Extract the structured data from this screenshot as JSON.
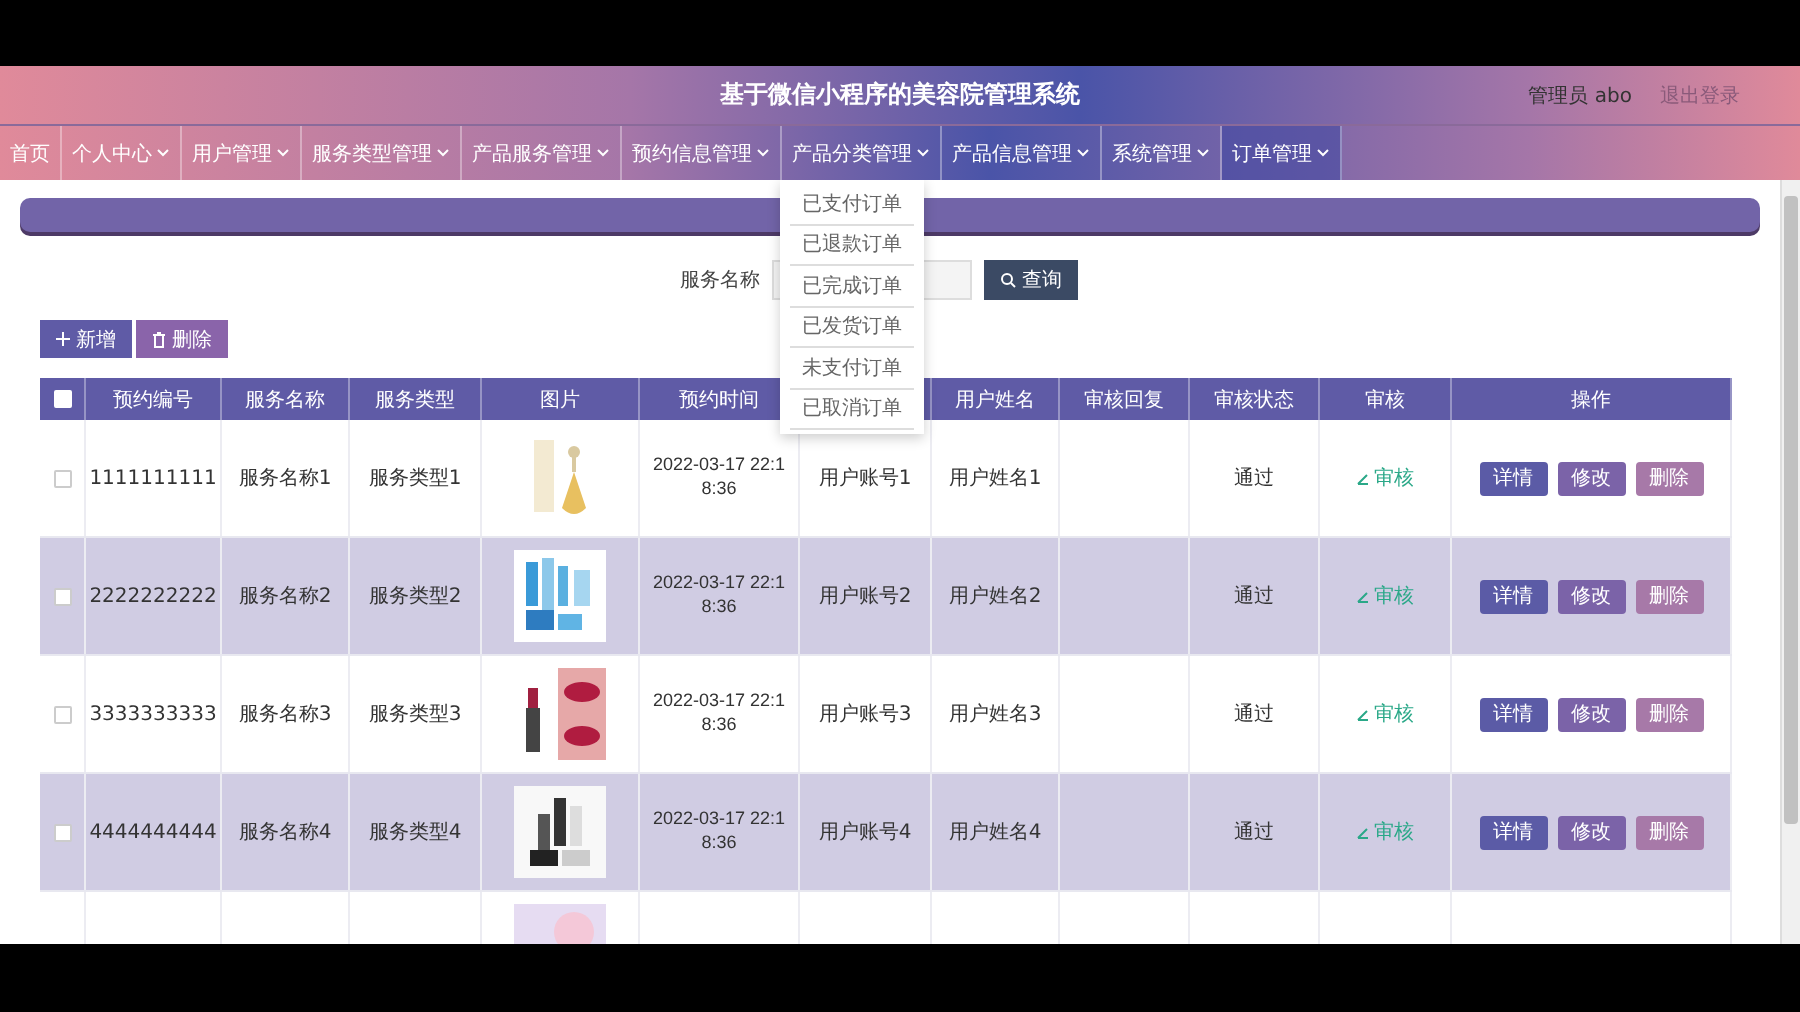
{
  "header": {
    "title": "基于微信小程序的美容院管理系统",
    "user": "管理员 abo",
    "logout": "退出登录"
  },
  "nav": [
    {
      "label": "首页",
      "dropdown": false,
      "selected": false
    },
    {
      "label": "个人中心",
      "dropdown": true,
      "selected": false
    },
    {
      "label": "用户管理",
      "dropdown": true,
      "selected": false
    },
    {
      "label": "服务类型管理",
      "dropdown": true,
      "selected": false
    },
    {
      "label": "产品服务管理",
      "dropdown": true,
      "selected": false
    },
    {
      "label": "预约信息管理",
      "dropdown": true,
      "selected": false
    },
    {
      "label": "产品分类管理",
      "dropdown": true,
      "selected": false
    },
    {
      "label": "产品信息管理",
      "dropdown": true,
      "selected": false
    },
    {
      "label": "系统管理",
      "dropdown": true,
      "selected": false
    },
    {
      "label": "订单管理",
      "dropdown": true,
      "selected": true
    }
  ],
  "dropdown": [
    "已支付订单",
    "已退款订单",
    "已完成订单",
    "已发货订单",
    "未支付订单",
    "已取消订单"
  ],
  "search": {
    "label": "服务名称",
    "button": "查询"
  },
  "toolbar": {
    "add": "新增",
    "delete": "删除"
  },
  "table": {
    "header_checked": false,
    "columns": [
      {
        "label": "预约编号"
      },
      {
        "label": "服务名称"
      },
      {
        "label": "服务类型"
      },
      {
        "label": "图片"
      },
      {
        "label": "预约时间"
      },
      {},
      {
        "label": "用户姓名"
      },
      {
        "label": "审核回复"
      },
      {
        "label": "审核状态"
      },
      {
        "label": "审核"
      },
      {
        "label": "操作"
      }
    ],
    "rows": [
      {
        "id": "1111111111",
        "service": "服务名称1",
        "type": "服务类型1",
        "picture": {
          "kind": "picture"
        },
        "time": "2022-03-17 22:1 8:36",
        "account": "用户账号1",
        "name": "用户姓名1",
        "status": "通过",
        "review": "审核",
        "actions": [
          "详情",
          "修改",
          "删除"
        ],
        "checked": false
      },
      {
        "id": "2222222222",
        "service": "服务名称2",
        "type": "服务类型2",
        "picture": {
          "kind": "picture"
        },
        "time": "2022-03-17 22:1 8:36",
        "account": "用户账号2",
        "name": "用户姓名2",
        "status": "通过",
        "review": "审核",
        "actions": [
          "详情",
          "修改",
          "删除"
        ],
        "checked": false
      },
      {
        "id": "3333333333",
        "service": "服务名称3",
        "type": "服务类型3",
        "picture": {
          "kind": "picture"
        },
        "time": "2022-03-17 22:1 8:36",
        "account": "用户账号3",
        "name": "用户姓名3",
        "status": "通过",
        "review": "审核",
        "actions": [
          "详情",
          "修改",
          "删除"
        ],
        "checked": false
      },
      {
        "id": "4444444444",
        "service": "服务名称4",
        "type": "服务类型4",
        "picture": {
          "kind": "picture"
        },
        "time": "2022-03-17 22:1 8:36",
        "account": "用户账号4",
        "name": "用户姓名4",
        "status": "通过",
        "review": "审核",
        "actions": [
          "详情",
          "修改",
          "删除"
        ],
        "checked": false
      },
      {
        "picture": {
          "kind": "picture"
        }
      }
    ]
  }
}
